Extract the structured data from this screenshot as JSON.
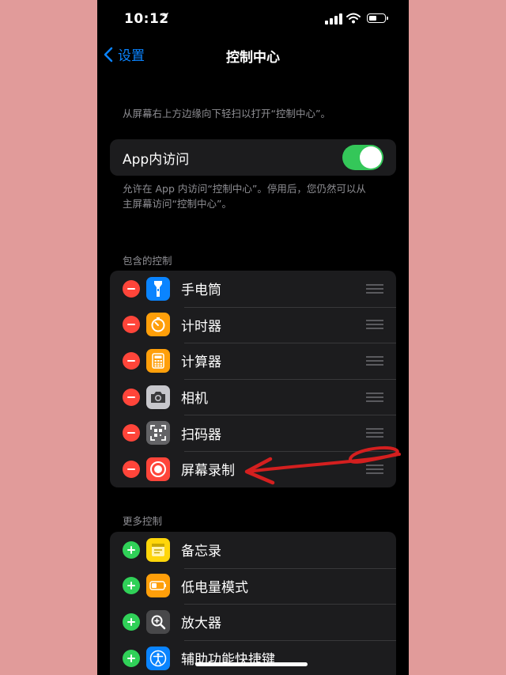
{
  "status_bar": {
    "time": "10:12",
    "location_icon": "location-arrow-icon",
    "battery_level": 0.5
  },
  "nav": {
    "back_label": "设置",
    "title": "控制中心"
  },
  "intro_note": "从屏幕右上方边缘向下轻扫以打开“控制中心”。",
  "access_toggle": {
    "label": "App内访问",
    "on": true
  },
  "access_note": [
    "允许在 App 内访问“控制中心”。停用后，您仍然可以从",
    "主屏幕访问“控制中心”。"
  ],
  "included": {
    "header": "包含的控制",
    "items": [
      {
        "label": "手电筒",
        "icon": "flashlight-icon",
        "color": "#0a84ff"
      },
      {
        "label": "计时器",
        "icon": "timer-icon",
        "color": "#ff9f0a"
      },
      {
        "label": "计算器",
        "icon": "calculator-icon",
        "color": "#ff9f0a"
      },
      {
        "label": "相机",
        "icon": "camera-icon",
        "color": "#8e8e93"
      },
      {
        "label": "扫码器",
        "icon": "qr-scanner-icon",
        "color": "#636366"
      },
      {
        "label": "屏幕录制",
        "icon": "screen-record-icon",
        "color": "#ff453a"
      }
    ]
  },
  "more": {
    "header": "更多控制",
    "items": [
      {
        "label": "备忘录",
        "icon": "notes-icon",
        "color": "#ffd60a"
      },
      {
        "label": "低电量模式",
        "icon": "low-power-icon",
        "color": "#ff9f0a"
      },
      {
        "label": "放大器",
        "icon": "magnifier-icon",
        "color": "#48484a"
      },
      {
        "label": "辅助功能快捷键",
        "icon": "accessibility-icon",
        "color": "#0a84ff"
      }
    ]
  },
  "annotation": {
    "color": "#d41f1f"
  }
}
